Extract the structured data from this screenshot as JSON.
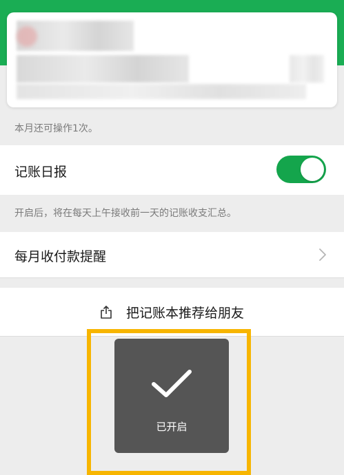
{
  "colors": {
    "header_green": "#1aad54",
    "toggle_on": "#14a54c",
    "highlight": "#f7b500",
    "toast_bg": "#555555"
  },
  "remaining_hint": "本月还可操作1次。",
  "daily_report": {
    "label": "记账日报",
    "enabled": true,
    "description": "开启后，将在每天上午接收前一天的记账收支汇总。"
  },
  "monthly_reminder": {
    "label": "每月收付款提醒",
    "icon": "chevron-right-icon"
  },
  "share": {
    "label": "把记账本推荐给朋友",
    "icon": "share-icon"
  },
  "toast": {
    "icon": "check-icon",
    "label": "已开启"
  }
}
